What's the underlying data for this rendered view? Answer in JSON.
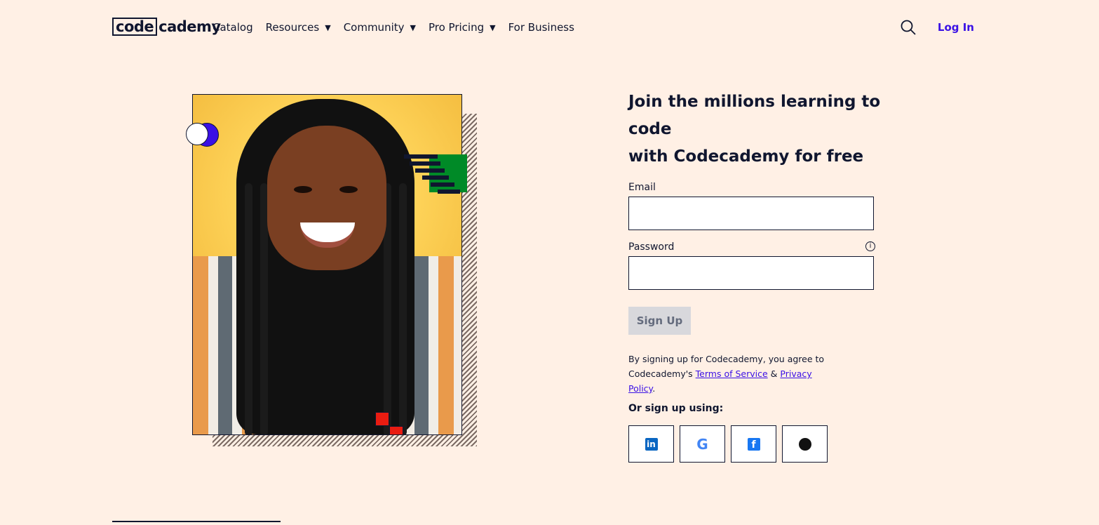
{
  "nav": {
    "logo_box": "code",
    "logo_rest": "cademy",
    "items": [
      {
        "label": "Catalog"
      },
      {
        "label": "Resources",
        "dropdown": true
      },
      {
        "label": "Community",
        "dropdown": true
      },
      {
        "label": "Pro Pricing",
        "dropdown": true
      },
      {
        "label": "For Business"
      }
    ],
    "search_icon": "search-icon",
    "login": "Log In"
  },
  "form": {
    "headline_1": "Join the millions learning to code",
    "headline_2": "with Codecademy for free",
    "email_label": "Email",
    "password_label": "Password",
    "signup": "Sign Up",
    "terms_prefix": "By signing up for Codecademy, you agree to Codecademy's",
    "terms_link": "Terms of Service",
    "terms_amp": "&",
    "privacy_link": "Privacy Policy",
    "terms_suffix": ".",
    "or_label": "Or sign up using:",
    "social": [
      "linkedin-icon",
      "google-icon",
      "facebook-icon",
      "github-icon"
    ]
  },
  "colors": {
    "background": "#fff0e5",
    "accent": "#3a10e5",
    "text": "#10162f"
  }
}
